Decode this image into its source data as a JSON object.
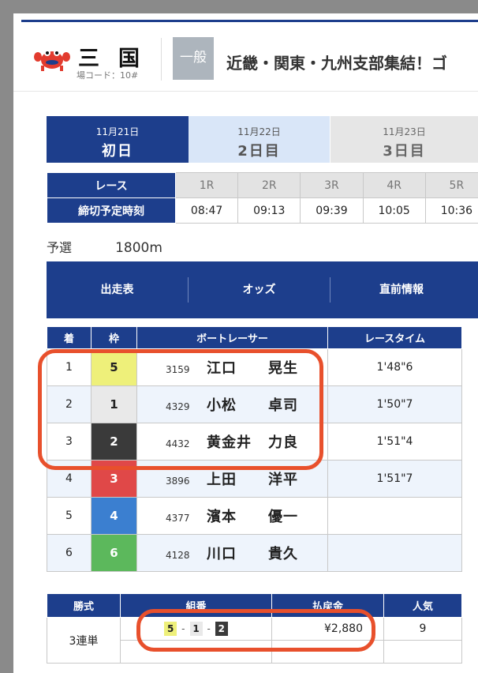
{
  "header": {
    "venue_name": "三国",
    "venue_code": "場コード：10#",
    "grade": "一般",
    "race_title": "近畿・関東・九州支部集結！ゴ"
  },
  "day_tabs": [
    {
      "date": "11月21日",
      "label": "初日",
      "active": true
    },
    {
      "date": "11月22日",
      "label": "2日目",
      "active": false
    },
    {
      "date": "11月23日",
      "label": "3日目",
      "active": false
    }
  ],
  "schedule": {
    "race_label": "レース",
    "deadline_label": "締切予定時刻",
    "races": [
      "1R",
      "2R",
      "3R",
      "4R",
      "5R"
    ],
    "times": [
      "08:47",
      "09:13",
      "09:39",
      "10:05",
      "10:36"
    ]
  },
  "race_info": {
    "type": "予選",
    "distance": "1800m"
  },
  "nav": {
    "entry": "出走表",
    "odds": "オッズ",
    "prerace": "直前情報"
  },
  "results": {
    "headers": [
      "着",
      "枠",
      "ボートレーサー",
      "レースタイム"
    ],
    "rows": [
      {
        "rank": "1",
        "frame": "5",
        "id": "3159",
        "family": "江口",
        "given": "晃生",
        "time": "1'48\"6"
      },
      {
        "rank": "2",
        "frame": "1",
        "id": "4329",
        "family": "小松",
        "given": "卓司",
        "time": "1'50\"7"
      },
      {
        "rank": "3",
        "frame": "2",
        "id": "4432",
        "family": "黄金井",
        "given": "力良",
        "time": "1'51\"4"
      },
      {
        "rank": "4",
        "frame": "3",
        "id": "3896",
        "family": "上田",
        "given": "洋平",
        "time": "1'51\"7"
      },
      {
        "rank": "5",
        "frame": "4",
        "id": "4377",
        "family": "濱本",
        "given": "優一",
        "time": ""
      },
      {
        "rank": "6",
        "frame": "6",
        "id": "4128",
        "family": "川口",
        "given": "貴久",
        "time": ""
      }
    ]
  },
  "frame_colors": {
    "1": {
      "bg": "#e9e9e9",
      "fg": "#222"
    },
    "2": {
      "bg": "#3a3a3a",
      "fg": "#ffffff"
    },
    "3": {
      "bg": "#e04848",
      "fg": "#ffffff"
    },
    "4": {
      "bg": "#3b7fd0",
      "fg": "#ffffff"
    },
    "5": {
      "bg": "#eef07a",
      "fg": "#222"
    },
    "6": {
      "bg": "#5cb85c",
      "fg": "#ffffff"
    }
  },
  "payout": {
    "headers": [
      "勝式",
      "組番",
      "払戻金",
      "人気"
    ],
    "bet_type": "3連単",
    "combo": [
      "5",
      "1",
      "2"
    ],
    "amount": "¥2,880",
    "popularity": "9"
  },
  "highlight_color": "#e8502c"
}
